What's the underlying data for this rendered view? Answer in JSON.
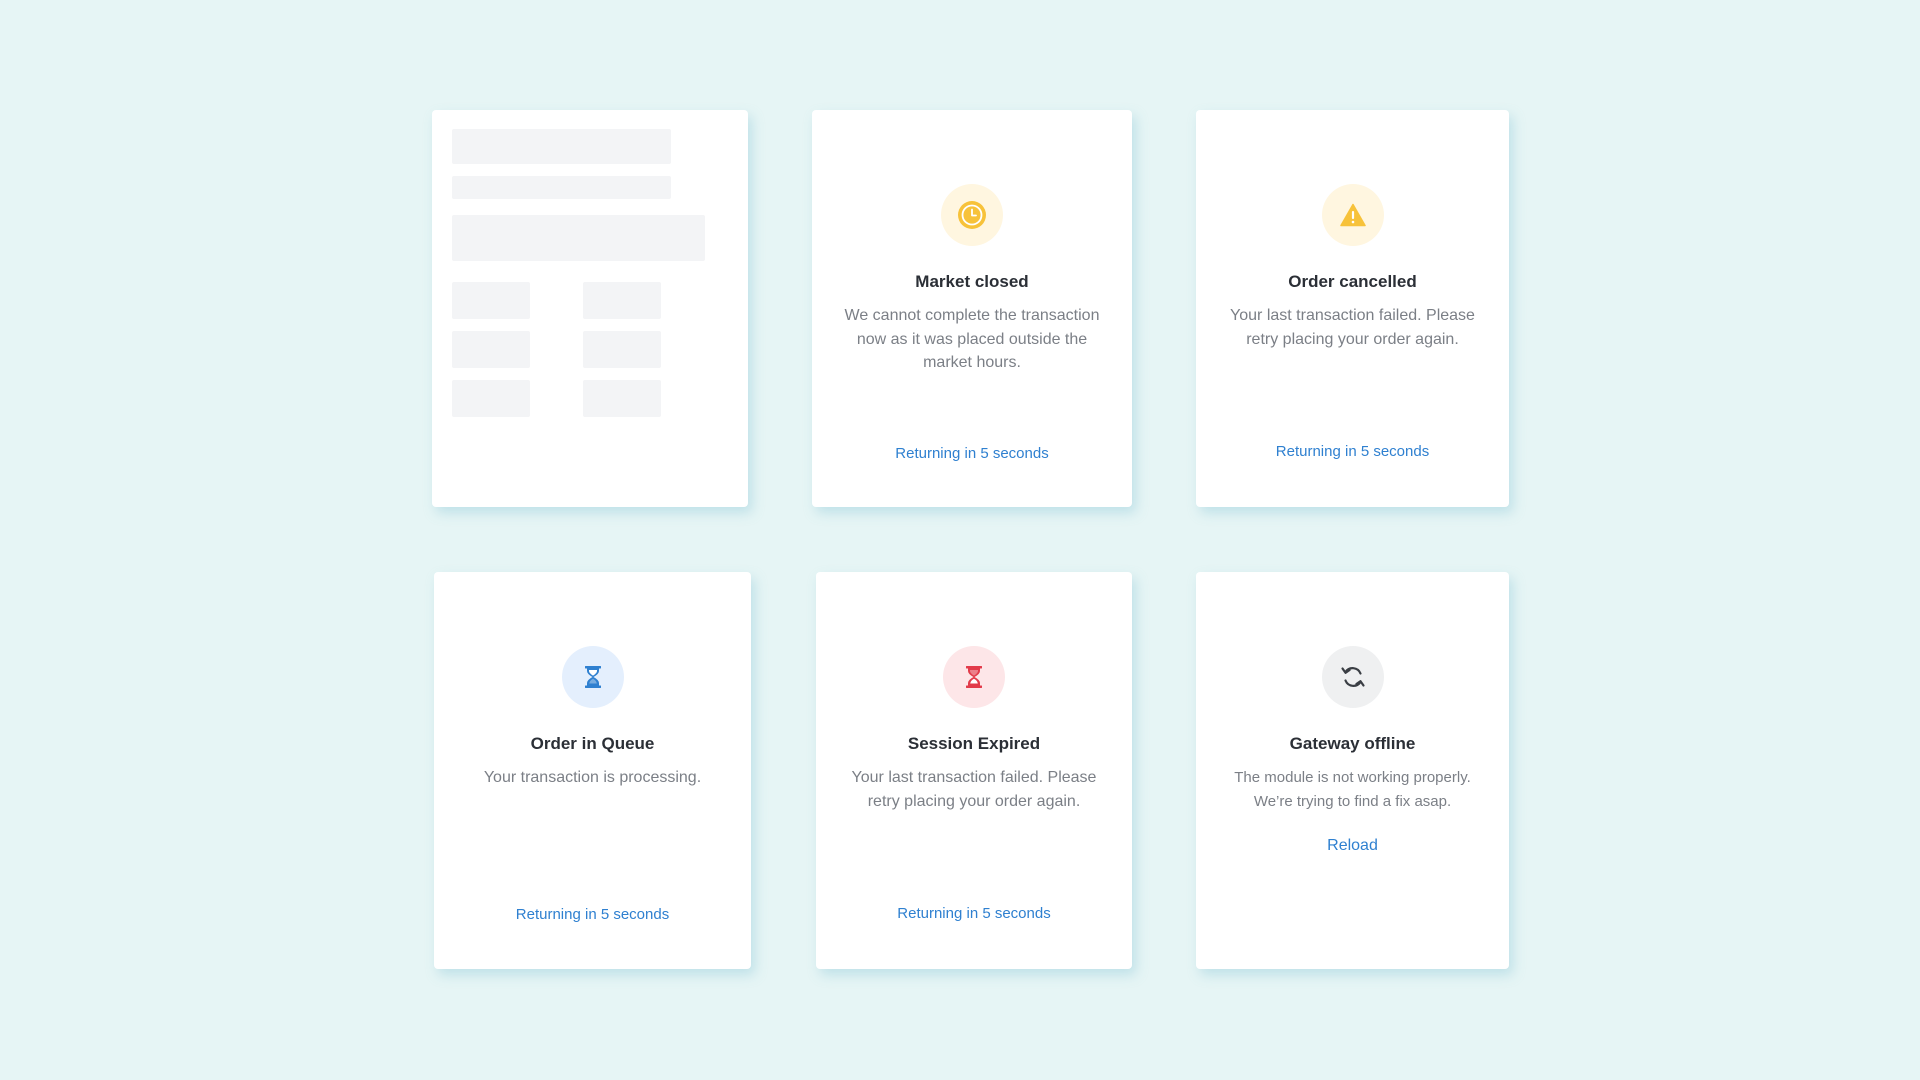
{
  "colors": {
    "background": "#e6f5f5",
    "card": "#ffffff",
    "link": "#2f80d0",
    "title": "#2b2f36",
    "text": "#7b7f86",
    "amber": "#f7c23a",
    "amber_bg": "#fff6e0",
    "blue": "#2f80d0",
    "blue_bg": "#e4effd",
    "red": "#e23b4a",
    "red_bg": "#fde6e8",
    "gray": "#3a3e44",
    "gray_bg": "#eff0f1"
  },
  "cards": {
    "market_closed": {
      "icon": "clock-icon",
      "title": "Market closed",
      "description": "We cannot complete the transaction now as it was placed outside the market hours.",
      "action": "Returning in 5 seconds"
    },
    "order_cancelled": {
      "icon": "warning-icon",
      "title": "Order cancelled",
      "description": "Your last transaction failed. Please retry placing your order again.",
      "action": "Returning in 5 seconds"
    },
    "order_queue": {
      "icon": "hourglass-icon",
      "title": "Order in Queue",
      "description": "Your transaction is processing.",
      "action": "Returning in 5 seconds"
    },
    "session_expired": {
      "icon": "hourglass-icon",
      "title": "Session Expired",
      "description": "Your last transaction failed. Please retry placing your order again.",
      "action": "Returning in 5 seconds"
    },
    "gateway_offline": {
      "icon": "refresh-icon",
      "title": "Gateway offline",
      "description": "The module is not working properly. We’re trying to find a fix asap.",
      "action": "Reload"
    }
  }
}
